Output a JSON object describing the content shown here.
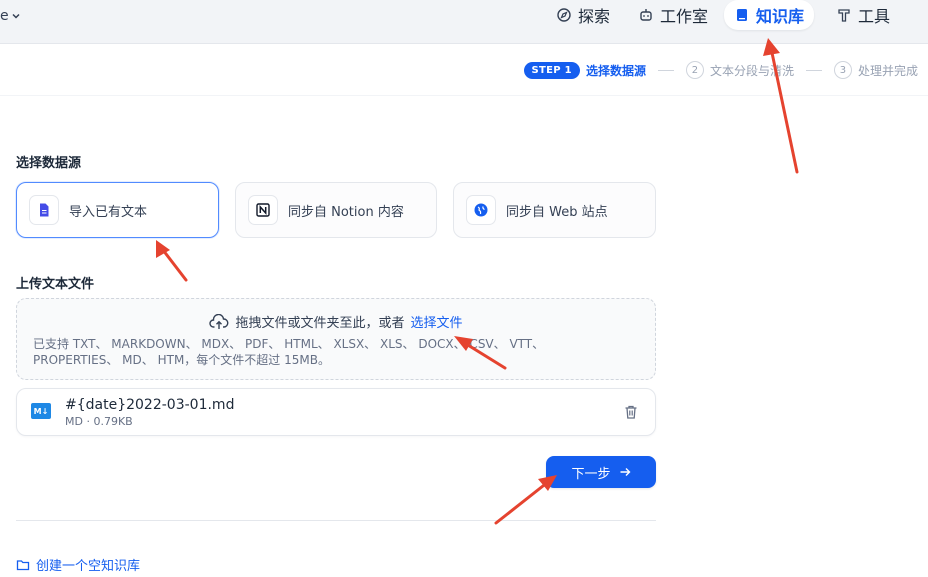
{
  "header": {
    "app_name_fragment": "e",
    "nav": [
      {
        "id": "explore",
        "label": "探索",
        "icon": "compass-icon"
      },
      {
        "id": "studio",
        "label": "工作室",
        "icon": "robot-icon"
      },
      {
        "id": "knowledge",
        "label": "知识库",
        "icon": "book-icon",
        "active": true
      },
      {
        "id": "tools",
        "label": "工具",
        "icon": "hammer-icon"
      }
    ]
  },
  "steps": {
    "current_badge": "STEP 1",
    "current_label": "选择数据源",
    "items": [
      {
        "num": "2",
        "label": "文本分段与清洗"
      },
      {
        "num": "3",
        "label": "处理并完成"
      }
    ]
  },
  "datasource": {
    "title": "选择数据源",
    "options": [
      {
        "label": "导入已有文本",
        "icon": "file-text-icon",
        "selected": true
      },
      {
        "label": "同步自 Notion 内容",
        "icon": "notion-icon",
        "selected": false
      },
      {
        "label": "同步自 Web 站点",
        "icon": "globe-icon",
        "selected": false
      }
    ]
  },
  "upload": {
    "title": "上传文本文件",
    "drop_text": "拖拽文件或文件夹至此，或者",
    "select_link": "选择文件",
    "hint": "已支持 TXT、 MARKDOWN、 MDX、 PDF、 HTML、 XLSX、 XLS、 DOCX、 CSV、 VTT、 PROPERTIES、 MD、 HTM，每个文件不超过 15MB。"
  },
  "file": {
    "icon_text": "M↓",
    "name": "#{date}2022-03-01.md",
    "meta": "MD · 0.79KB"
  },
  "actions": {
    "next_label": "下一步",
    "create_empty": "创建一个空知识库"
  },
  "colors": {
    "primary": "#155eef",
    "annotation_arrow": "#e5432f"
  }
}
